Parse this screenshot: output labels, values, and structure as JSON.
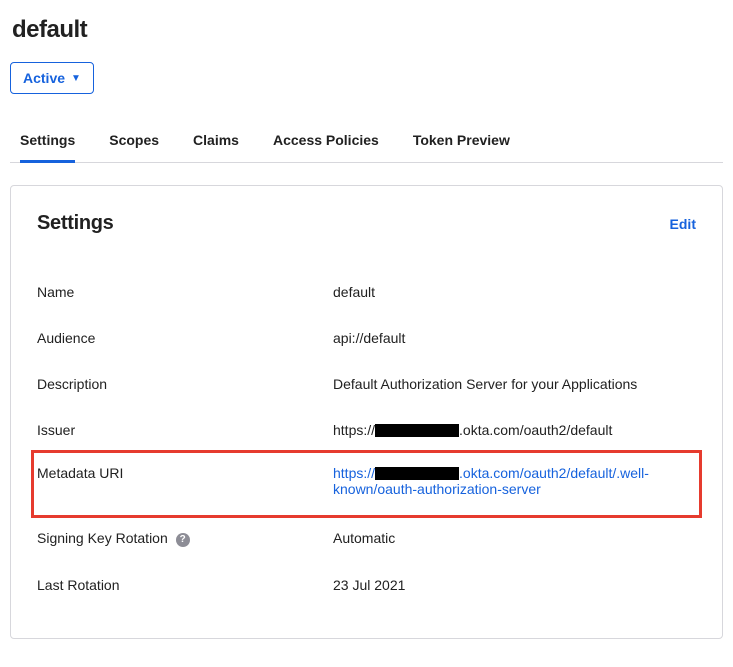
{
  "page_title": "default",
  "status": {
    "label": "Active"
  },
  "tabs": [
    {
      "label": "Settings",
      "active": true
    },
    {
      "label": "Scopes",
      "active": false
    },
    {
      "label": "Claims",
      "active": false
    },
    {
      "label": "Access Policies",
      "active": false
    },
    {
      "label": "Token Preview",
      "active": false
    }
  ],
  "panel": {
    "title": "Settings",
    "edit_label": "Edit",
    "rows": {
      "name": {
        "label": "Name",
        "value": "default"
      },
      "audience": {
        "label": "Audience",
        "value": "api://default"
      },
      "description": {
        "label": "Description",
        "value": "Default Authorization Server for your Applications"
      },
      "issuer": {
        "label": "Issuer",
        "prefix": "https://",
        "suffix": ".okta.com/oauth2/default"
      },
      "metadata_uri": {
        "label": "Metadata URI",
        "prefix": "https://",
        "suffix": ".okta.com/oauth2/default/.well-known/oauth-authorization-server"
      },
      "signing_key_rotation": {
        "label": "Signing Key Rotation",
        "value": "Automatic"
      },
      "last_rotation": {
        "label": "Last Rotation",
        "value": "23 Jul 2021"
      }
    }
  }
}
